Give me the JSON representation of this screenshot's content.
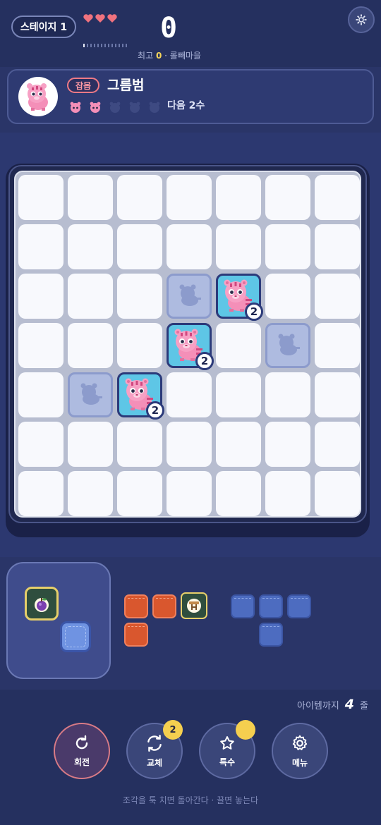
{
  "header": {
    "stage_label": "스테이지 1",
    "lives": 3,
    "score": "0",
    "best_label": "최고",
    "best_value": "0",
    "separator": "·",
    "mode_label": "롤빼마을",
    "settings_icon": "gear-icon"
  },
  "next_piece": {
    "badge": "잡몹",
    "name": "그름범",
    "queue_filled": 2,
    "queue_total": 5,
    "turns_text": "다음 2수"
  },
  "board": {
    "cols": 7,
    "rows": 7,
    "cells": [
      {
        "row": 2,
        "col": 3,
        "type": "ghost"
      },
      {
        "row": 2,
        "col": 4,
        "type": "tiger",
        "level": "2"
      },
      {
        "row": 3,
        "col": 3,
        "type": "tiger",
        "level": "2"
      },
      {
        "row": 3,
        "col": 5,
        "type": "ghost"
      },
      {
        "row": 4,
        "col": 1,
        "type": "ghost"
      },
      {
        "row": 4,
        "col": 2,
        "type": "tiger",
        "level": "2"
      }
    ]
  },
  "tray": {
    "items": [
      "plum-item-icon",
      "blue-block"
    ]
  },
  "upcoming_pieces": [
    {
      "kind": "orange-block"
    },
    {
      "kind": "orange-block"
    },
    {
      "kind": "lamp-item-icon"
    },
    {
      "kind": "orange-block"
    },
    {
      "kind": "blue-block"
    },
    {
      "kind": "blue-block"
    },
    {
      "kind": "blue-block"
    },
    {
      "kind": "blue-block"
    }
  ],
  "until_item": {
    "label": "아이템까지",
    "count": "4",
    "unit": "줄"
  },
  "actions": [
    {
      "label": "회전",
      "icon": "rotate-icon"
    },
    {
      "label": "교체",
      "icon": "swap-icon",
      "badge": "2"
    },
    {
      "label": "특수",
      "icon": "star-icon",
      "badge": ""
    },
    {
      "label": "메뉴",
      "icon": "gear-icon"
    }
  ],
  "hint": "조각을 툭 치면 돌아간다 · 끌면 놓는다",
  "colors": {
    "background": "#2a3568",
    "tile": "#f8f9fd",
    "tiger_tile": "#5ec6e6",
    "ghost_tile": "#aebbe0",
    "orange_block": "#d9572e",
    "blue_block": "#4d6cc0",
    "accent_yellow": "#f5cf4f",
    "heart": "#f0727e"
  }
}
